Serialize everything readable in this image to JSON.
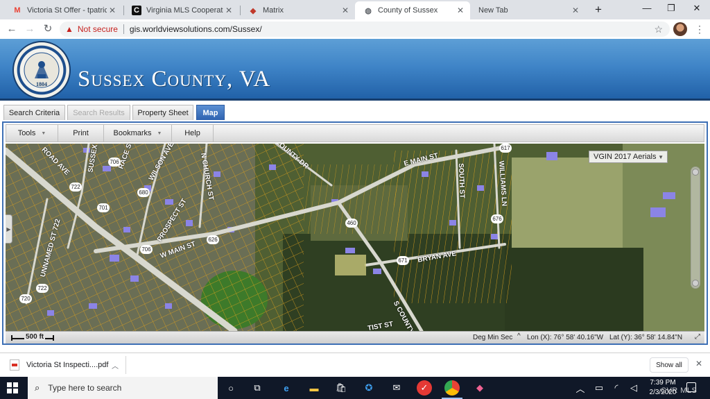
{
  "browser": {
    "tabs": [
      {
        "title": "Victoria St Offer - tpatrickb",
        "favicon": "gmail-icon",
        "color": "#ea4335",
        "active": false
      },
      {
        "title": "Virginia MLS Cooperative",
        "favicon": "mls-icon",
        "color": "#111111",
        "active": false
      },
      {
        "title": "Matrix",
        "favicon": "matrix-icon",
        "color": "#c0392b",
        "active": false
      },
      {
        "title": "County of Sussex",
        "favicon": "globe-icon",
        "color": "#5f6368",
        "active": true
      },
      {
        "title": "New Tab",
        "favicon": "",
        "color": "",
        "active": false
      }
    ],
    "new_tab_symbol": "+",
    "security_label": "Not secure",
    "url": "gis.worldviewsolutions.com/Sussex/"
  },
  "header": {
    "title": "Sussex County, VA",
    "seal_year": "1804"
  },
  "app_tabs": [
    {
      "label": "Search Criteria",
      "state": "normal"
    },
    {
      "label": "Search Results",
      "state": "disabled"
    },
    {
      "label": "Property Sheet",
      "state": "normal"
    },
    {
      "label": "Map",
      "state": "active"
    }
  ],
  "menu": [
    {
      "label": "Tools",
      "dropdown": true
    },
    {
      "label": "Print",
      "dropdown": false
    },
    {
      "label": "Bookmarks",
      "dropdown": true
    },
    {
      "label": "Help",
      "dropdown": false
    }
  ],
  "map": {
    "basemap": "VGIN 2017 Aerials",
    "road_labels": [
      {
        "text": "E MAIN ST"
      },
      {
        "text": "W MAIN ST"
      },
      {
        "text": "BRYAN AVE"
      },
      {
        "text": "PROSPECT ST"
      },
      {
        "text": "WILSON AVE"
      },
      {
        "text": "N CHURCH ST"
      },
      {
        "text": "SOUTH ST"
      },
      {
        "text": "WILLIAMS LN"
      },
      {
        "text": "UNNAMED ST 722"
      },
      {
        "text": "S COUNTY"
      },
      {
        "text": "COUNTY DR"
      },
      {
        "text": "SUSSEX"
      },
      {
        "text": "RACE ST"
      },
      {
        "text": "ROAD AVE"
      },
      {
        "text": "TIST ST"
      }
    ],
    "route_shields": [
      "706",
      "722",
      "680",
      "701",
      "626",
      "460",
      "671",
      "676",
      "617",
      "720",
      "722",
      "706"
    ],
    "scale_label": "500 ft",
    "coord_format": "Deg Min Sec",
    "coord_caret": "^",
    "lon_text": "Lon (X): 76° 58' 40.16\"W",
    "lat_text": "Lat (Y): 36° 58' 14.84\"N"
  },
  "downloads": {
    "file_name": "Victoria St Inspecti....pdf",
    "show_all": "Show all"
  },
  "taskbar": {
    "search_placeholder": "Type here to search",
    "time": "7:39 PM",
    "date": "2/3/2020"
  },
  "watermark": "CVR MLS"
}
